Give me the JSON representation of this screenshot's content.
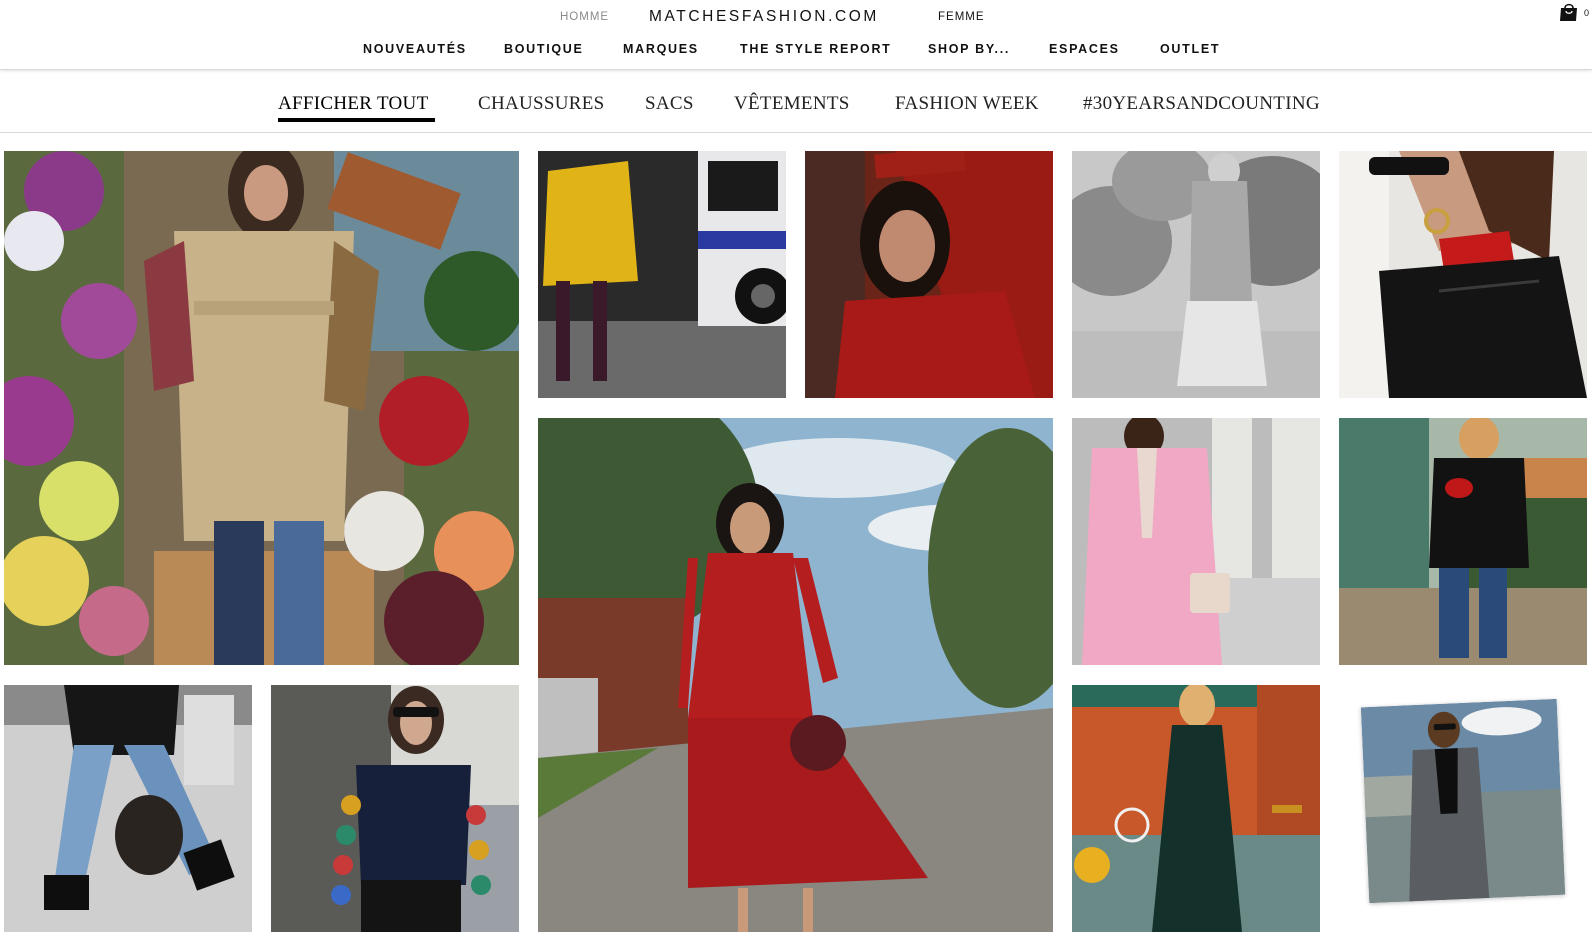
{
  "header": {
    "gender_left": "HOMME",
    "logo": "MATCHESFASHION.COM",
    "gender_right": "FEMME",
    "bag_count": "0"
  },
  "main_nav": [
    "NOUVEAUTÉS",
    "BOUTIQUE",
    "MARQUES",
    "THE STYLE REPORT",
    "SHOP BY...",
    "ESPACES",
    "OUTLET"
  ],
  "sub_nav": {
    "active_index": 0,
    "items": [
      "AFFICHER TOUT",
      "CHAUSSURES",
      "SACS",
      "VÊTEMENTS",
      "FASHION WEEK",
      "#30YEARSANDCOUNTING"
    ]
  },
  "grid": {
    "tiles": [
      {
        "id": "trench-coat-flower-market",
        "subject": "trench-coat-flowers"
      },
      {
        "id": "yellow-coat-bus",
        "subject": "yellow-coat"
      },
      {
        "id": "red-dress-portrait",
        "subject": "red-portrait"
      },
      {
        "id": "grey-coat-bw",
        "subject": "bw-coat"
      },
      {
        "id": "red-collar-earring",
        "subject": "earring"
      },
      {
        "id": "red-dress-street",
        "subject": "red-dress-street"
      },
      {
        "id": "pink-blazer",
        "subject": "pink-blazer"
      },
      {
        "id": "black-jacket-canal",
        "subject": "canal"
      },
      {
        "id": "jeans-net-bag",
        "subject": "jeans-heels"
      },
      {
        "id": "crochet-sleeves",
        "subject": "crochet-sweater"
      },
      {
        "id": "green-slip-dress",
        "subject": "green-dress"
      },
      {
        "id": "check-suit-polaroid",
        "subject": "check-suit"
      }
    ]
  },
  "colors": {
    "nav_text": "#111111",
    "muted_text": "#8a8a8a",
    "active_underline": "#000000",
    "divider": "#d9d9d9"
  }
}
